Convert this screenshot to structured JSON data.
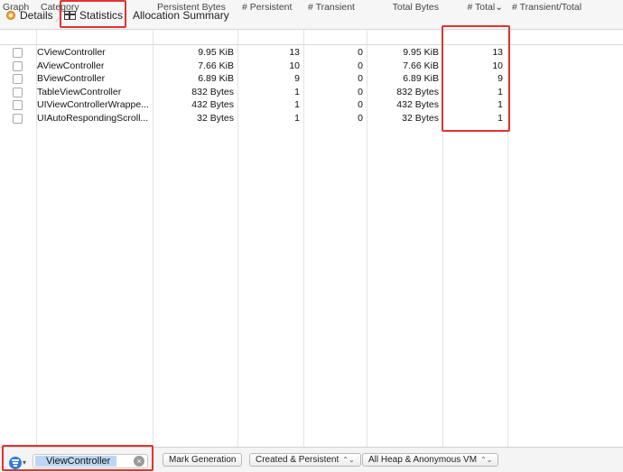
{
  "breadcrumb": {
    "details_label": "Details",
    "statistics_label": "Statistics",
    "allocation_summary_label": "Allocation Summary"
  },
  "table": {
    "columns": [
      "Graph",
      "Category",
      "Persistent Bytes",
      "# Persistent",
      "# Transient",
      "Total Bytes",
      "# Total",
      "# Transient/Total"
    ],
    "sort_indicator": "⌄",
    "rows": [
      {
        "category": "CViewController",
        "persistent_bytes": "9.95 KiB",
        "persistent": "13",
        "transient": "0",
        "total_bytes": "9.95 KiB",
        "total": "13"
      },
      {
        "category": "AViewController",
        "persistent_bytes": "7.66 KiB",
        "persistent": "10",
        "transient": "0",
        "total_bytes": "7.66 KiB",
        "total": "10"
      },
      {
        "category": "BViewController",
        "persistent_bytes": "6.89 KiB",
        "persistent": "9",
        "transient": "0",
        "total_bytes": "6.89 KiB",
        "total": "9"
      },
      {
        "category": "TableViewController",
        "persistent_bytes": "832 Bytes",
        "persistent": "1",
        "transient": "0",
        "total_bytes": "832 Bytes",
        "total": "1"
      },
      {
        "category": "UIViewControllerWrappe...",
        "persistent_bytes": "432 Bytes",
        "persistent": "1",
        "transient": "0",
        "total_bytes": "432 Bytes",
        "total": "1"
      },
      {
        "category": "UIAutoRespondingScroll...",
        "persistent_bytes": "32 Bytes",
        "persistent": "1",
        "transient": "0",
        "total_bytes": "32 Bytes",
        "total": "1"
      }
    ]
  },
  "bottom_bar": {
    "filter_value": "ViewController",
    "mark_generation_label": "Mark Generation",
    "lifespan_select": "Created & Persistent",
    "heap_select": "All Heap & Anonymous VM"
  },
  "colors": {
    "highlight_box": "#e0342f",
    "filter_accent": "#2f7de1",
    "search_selection": "#bcd6f5"
  },
  "icons": [
    "details-dot-icon",
    "chevron-right-icon",
    "table-grid-icon",
    "sort-descending-icon",
    "filter-icon",
    "chevron-down-icon",
    "clear-icon",
    "up-down-icon"
  ]
}
